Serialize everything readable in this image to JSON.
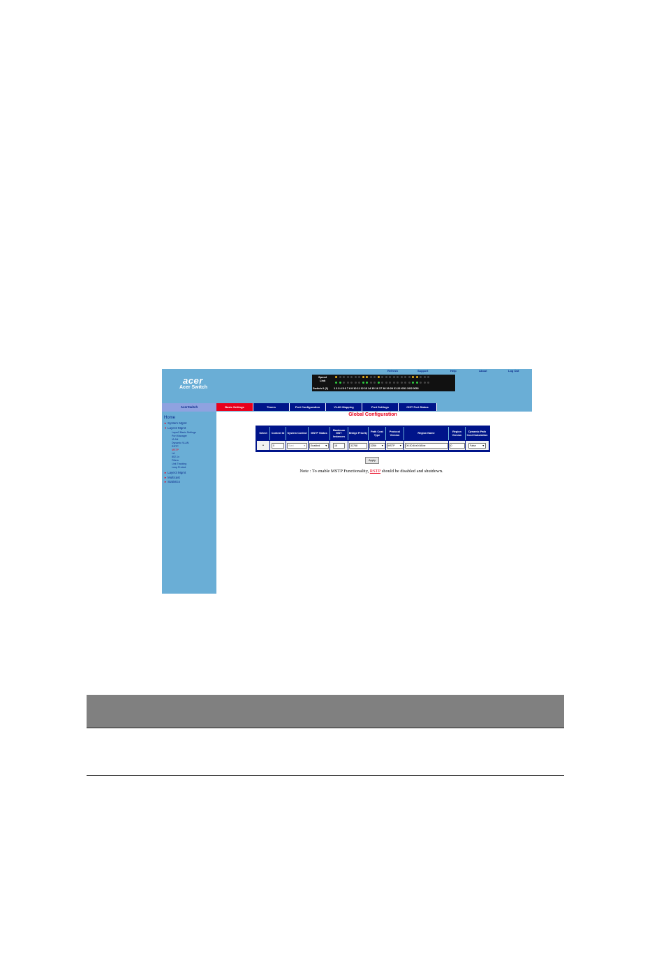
{
  "header": {
    "logo": "acer",
    "product": "Acer Switch",
    "links": [
      "Refresh",
      "Support",
      "Help",
      "About",
      "Log Out"
    ]
  },
  "port_panel": {
    "speed_label": "Speed",
    "link_label": "Link",
    "unit_label": "Switch 0 (1)",
    "port_numbers": "1 2 3 4 5 6 7 8 9 10 11 12 13 14 15 16 17 18 19 20 21 22 XG1 XG2 XG3"
  },
  "brand_tab": "AcerSwitch",
  "tabs": [
    {
      "label": "Basic Settings",
      "active": true
    },
    {
      "label": "Timers",
      "active": false
    },
    {
      "label": "Port Configuration",
      "active": false
    },
    {
      "label": "VLAN Mapping",
      "active": false
    },
    {
      "label": "Port Settings",
      "active": false
    },
    {
      "label": "CIST Port Status",
      "active": false
    }
  ],
  "sidebar": {
    "home": "Home",
    "system_mgmt": "System Mgmt",
    "layer2_mgmt": "Layer2 Mgmt",
    "layer2_items": [
      "Layer2 Basic Settings",
      "Port Manager",
      "VLAN",
      "Dynamic VLAN",
      "RSTP",
      "MSTP",
      "LA",
      "802.1x",
      "Filters",
      "Link Tracking",
      "Loop Protect"
    ],
    "current_item": "MSTP",
    "layer3_mgmt": "Layer3 Mgmt",
    "multicast": "Multicast",
    "statistics": "Statistics"
  },
  "page_title": "Global Configuration",
  "table": {
    "headers": [
      "Select",
      "Context Id",
      "System Control",
      "MSTP Status",
      "Maximum MST Instances",
      "Bridge Priority",
      "Path Cost Type",
      "Protocol Version",
      "Region Name",
      "Region Version",
      "Dynamic Path Cost Calculation"
    ],
    "row": {
      "select": "•",
      "context_id": "0",
      "system_control": "Start",
      "mstp_status": "Enabled",
      "max_instances": "16",
      "bridge_priority": "32768",
      "path_cost_type": "32Bit",
      "protocol_version": "MSTP",
      "region_name": "00:30:4f:e0:08:be",
      "region_version": "0",
      "dynamic_path_cost": "False"
    }
  },
  "apply_label": "Apply",
  "note": {
    "before": "Note : To enable MSTP Functionality,",
    "link": "RSTP",
    "after": "should be disabled and shutdown."
  }
}
